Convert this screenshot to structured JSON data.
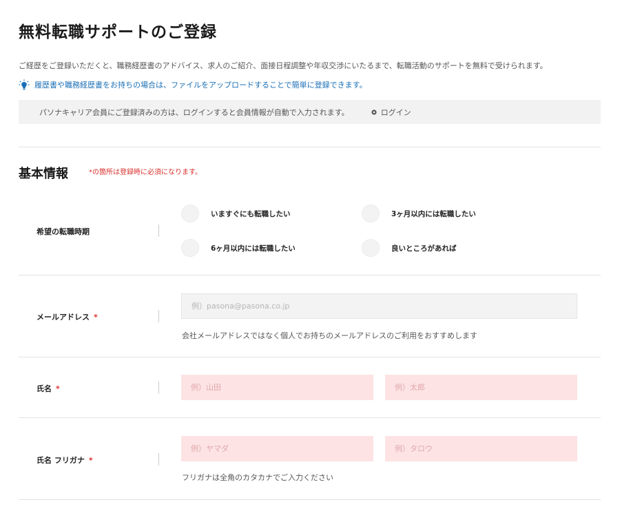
{
  "page": {
    "title": "無料転職サポートのご登録",
    "intro": "ご経歴をご登録いただくと、職務経歴書のアドバイス、求人のご紹介、面接日程調整や年収交渉にいたるまで、転職活動のサポートを無料で受けられます。",
    "upload_hint": "履歴書や職務経歴書をお持ちの場合は、ファイルをアップロードすることで簡単に登録できます。",
    "member_notice": "パソナキャリア会員にご登録済みの方は、ログインすると会員情報が自動で入力されます。",
    "login_label": "ログイン"
  },
  "section": {
    "title": "基本情報",
    "required_note": "*の箇所は登録時に必須になります。"
  },
  "fields": {
    "timing": {
      "label": "希望の転職時期",
      "options": [
        "いますぐにも転職したい",
        "3ヶ月以内には転職したい",
        "6ヶ月以内には転職したい",
        "良いところがあれば"
      ]
    },
    "email": {
      "label": "メールアドレス",
      "required_mark": "*",
      "placeholder": "例）pasona@pasona.co.jp",
      "help": "会社メールアドレスではなく個人でお持ちのメールアドレスのご利用をおすすめします"
    },
    "name": {
      "label": "氏名",
      "required_mark": "*",
      "last_placeholder": "例）山田",
      "first_placeholder": "例）太郎"
    },
    "furigana": {
      "label": "氏名 フリガナ",
      "required_mark": "*",
      "last_placeholder": "例）ヤマダ",
      "first_placeholder": "例）タロウ",
      "help": "フリガナは全角のカタカナでご入力ください"
    }
  },
  "colors": {
    "required": "#d9302c",
    "link": "#1a6fb5",
    "required_input_bg": "#fde3e4",
    "input_bg": "#f3f3f3"
  },
  "icons": {
    "upload_hint": "lightbulb-icon",
    "login": "circle-bullet-icon"
  }
}
